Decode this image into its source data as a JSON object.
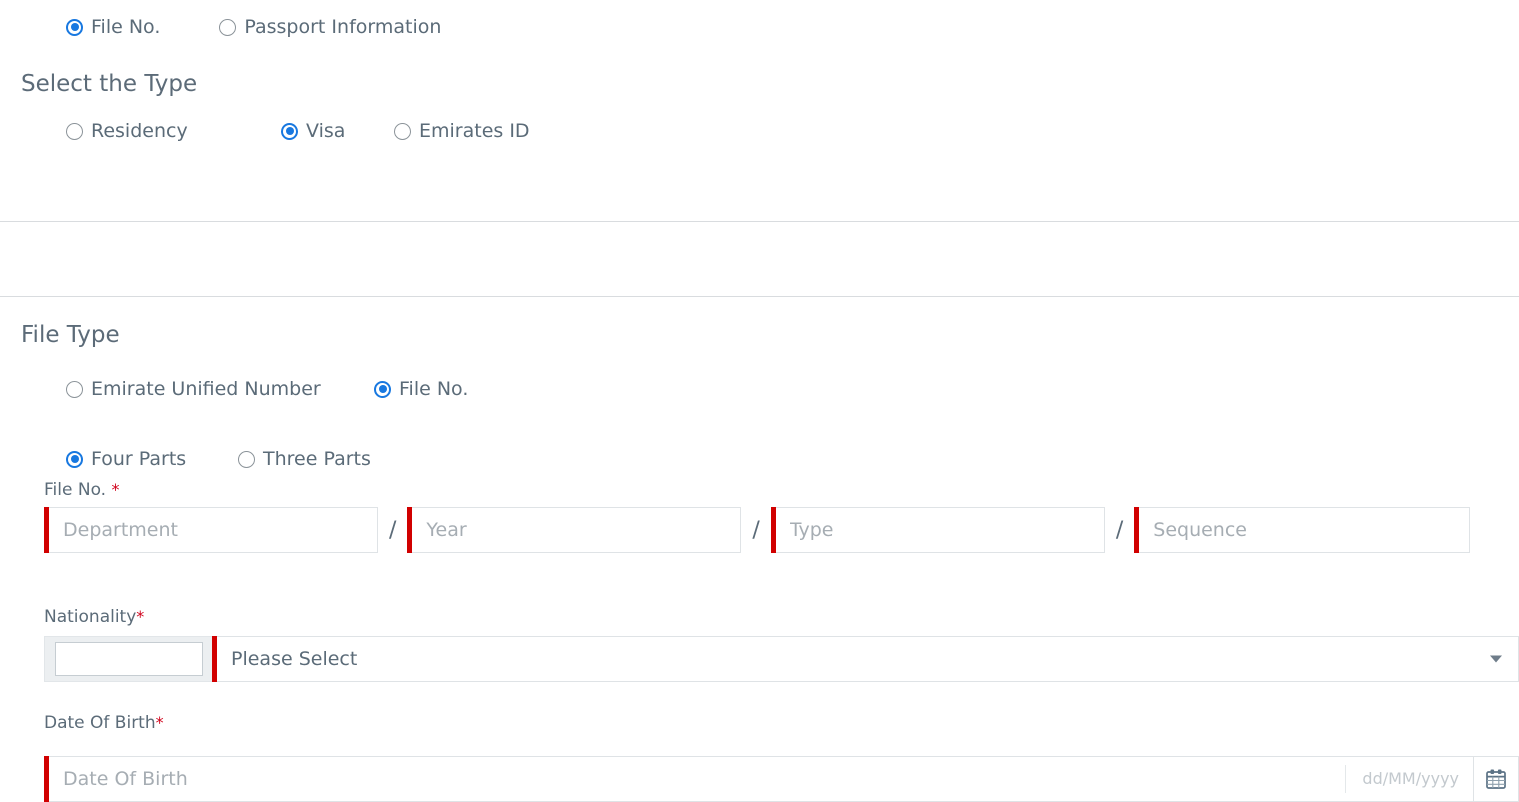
{
  "top_choice": {
    "options": [
      {
        "label": "File No.",
        "selected": true
      },
      {
        "label": "Passport Information",
        "selected": false
      }
    ]
  },
  "select_type": {
    "heading": "Select the Type",
    "options": [
      {
        "label": "Residency",
        "selected": false
      },
      {
        "label": "Visa",
        "selected": true
      },
      {
        "label": "Emirates ID",
        "selected": false
      }
    ]
  },
  "file_type": {
    "heading": "File Type",
    "id_options": [
      {
        "label": "Emirate Unified Number",
        "selected": false
      },
      {
        "label": "File No.",
        "selected": true
      }
    ],
    "parts_options": [
      {
        "label": "Four Parts",
        "selected": true
      },
      {
        "label": "Three Parts",
        "selected": false
      }
    ],
    "file_no_label": "File No.",
    "file_no_required_mark": "*",
    "separator": "/",
    "parts": [
      {
        "placeholder": "Department",
        "value": ""
      },
      {
        "placeholder": "Year",
        "value": ""
      },
      {
        "placeholder": "Type",
        "value": ""
      },
      {
        "placeholder": "Sequence",
        "value": ""
      }
    ]
  },
  "nationality": {
    "label": "Nationality",
    "required_mark": "*",
    "selected_text": "Please Select",
    "caret_icon": "chevron-down-icon"
  },
  "date_of_birth": {
    "label": "Date Of Birth",
    "required_mark": "*",
    "placeholder": "Date Of Birth",
    "value": "",
    "format_hint": "dd/MM/yyyy",
    "calendar_icon": "calendar-icon"
  },
  "colors": {
    "accent_blue": "#1878e0",
    "required_red": "#d10000",
    "asterisk_red": "#d0021b",
    "text_slate": "#5b6b78",
    "placeholder_gray": "#a6adb3",
    "divider": "#d9dcdf"
  }
}
